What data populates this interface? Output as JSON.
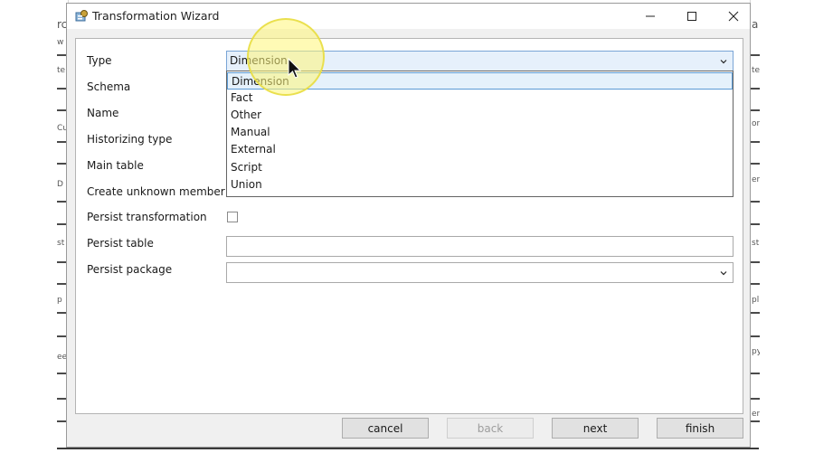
{
  "window": {
    "title": "Transformation Wizard"
  },
  "form": {
    "labels": {
      "type": "Type",
      "schema": "Schema",
      "name": "Name",
      "historizing_type": "Historizing type",
      "main_table": "Main table",
      "create_unknown_member": "Create unknown member",
      "persist_transformation": "Persist transformation",
      "persist_table": "Persist table",
      "persist_package": "Persist package"
    },
    "type_value": "Dimension",
    "persist_transformation_checked": false,
    "persist_table_value": "",
    "persist_package_value": ""
  },
  "dropdown": {
    "options": [
      "Dimension",
      "Fact",
      "Other",
      "Manual",
      "External",
      "Script",
      "Union"
    ],
    "selected": "Dimension"
  },
  "buttons": {
    "cancel": "cancel",
    "back": "back",
    "next": "next",
    "finish": "finish"
  },
  "background": {
    "left_fragments": [
      "rc",
      "w",
      "te",
      "Cu",
      "D",
      "st",
      "p",
      "ee"
    ],
    "right_fragments": [
      "a",
      "te",
      "on",
      "en",
      "st",
      "pl",
      "py",
      "er"
    ]
  },
  "colors": {
    "dropdown_selected": "#e5f1fb",
    "dropdown_selected_border": "#5b9bd5",
    "highlight": "#fff578"
  }
}
